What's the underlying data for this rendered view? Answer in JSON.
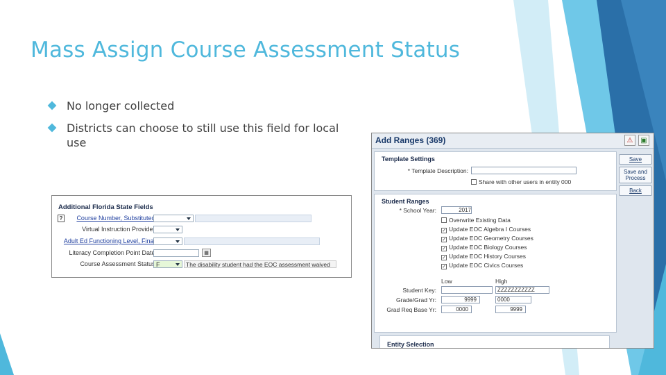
{
  "slide": {
    "title": "Mass Assign Course Assessment Status",
    "bullets": [
      "No longer collected",
      "Districts can choose to still use this field for local use"
    ],
    "accent_color": "#4fb8dc"
  },
  "left_screenshot": {
    "header": "Additional Florida State Fields",
    "help_icon": "?",
    "fields": [
      {
        "label": "Course Number, Substituted:"
      },
      {
        "label": "Virtual Instruction Provider:"
      },
      {
        "label": "Adult Ed Functioning Level, Final:"
      },
      {
        "label": "Literacy Completion Point Date:"
      },
      {
        "label": "Course Assessment Status:",
        "value": "F",
        "description": "The disability student had the EOC assessment waived"
      }
    ]
  },
  "right_screenshot": {
    "title": "Add Ranges (369)",
    "template_settings": {
      "heading": "Template Settings",
      "description_label": "* Template Description:",
      "share_label": "Share with other users in entity 000"
    },
    "student_ranges": {
      "heading": "Student Ranges",
      "school_year_label": "* School Year:",
      "school_year_value": "2017",
      "checkboxes": [
        {
          "label": "Overwrite Existing Data",
          "checked": false
        },
        {
          "label": "Update EOC Algebra I Courses",
          "checked": true
        },
        {
          "label": "Update EOC Geometry Courses",
          "checked": true
        },
        {
          "label": "Update EOC Biology Courses",
          "checked": true
        },
        {
          "label": "Update EOC History Courses",
          "checked": true
        },
        {
          "label": "Update EOC Civics Courses",
          "checked": true
        }
      ],
      "low_label": "Low",
      "high_label": "High",
      "rows": [
        {
          "label": "Student Key:",
          "low": "",
          "high": "ZZZZZZZZZZZ"
        },
        {
          "label": "Grade/Grad Yr:",
          "low": "9999",
          "high": "0000"
        },
        {
          "label": "Grad Req Base Yr:",
          "low": "0000",
          "high": "9999"
        }
      ]
    },
    "entity_selection": {
      "heading": "Entity Selection"
    },
    "actions": [
      "Save",
      "Save and Process",
      "Back"
    ]
  }
}
